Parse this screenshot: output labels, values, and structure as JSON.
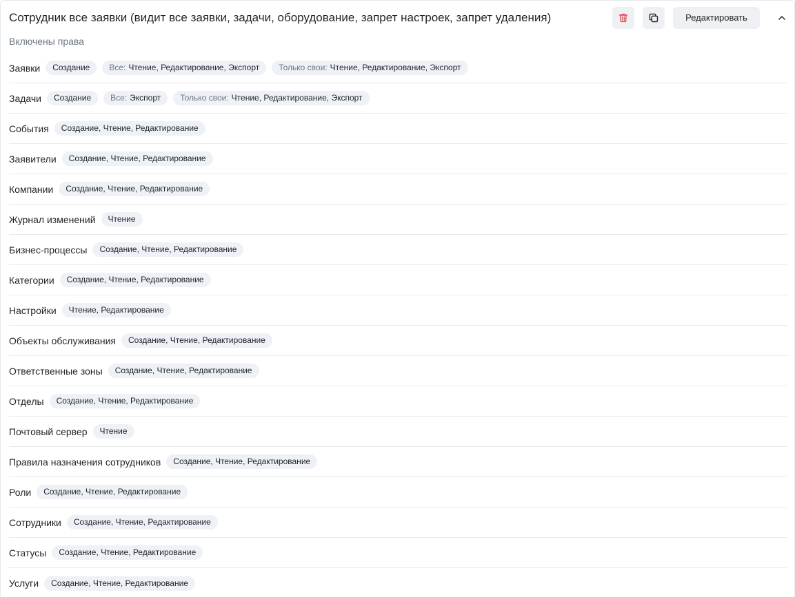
{
  "header": {
    "title": "Сотрудник все заявки (видит все заявки, задачи, оборудование, запрет настроек, запрет удаления)",
    "edit_label": "Редактировать",
    "delete_icon": "trash-icon",
    "copy_icon": "copy-icon",
    "collapse_icon": "chevron-up-icon",
    "delete_color": "#e5484d"
  },
  "subtitle": "Включены права",
  "rows": [
    {
      "label": "Заявки",
      "tags": [
        {
          "scope": "",
          "text": "Создание"
        },
        {
          "scope": "Все:",
          "text": "Чтение, Редактирование, Экспорт"
        },
        {
          "scope": "Только свои:",
          "text": "Чтение, Редактирование, Экспорт"
        }
      ]
    },
    {
      "label": "Задачи",
      "tags": [
        {
          "scope": "",
          "text": "Создание"
        },
        {
          "scope": "Все:",
          "text": "Экспорт"
        },
        {
          "scope": "Только свои:",
          "text": "Чтение, Редактирование, Экспорт"
        }
      ]
    },
    {
      "label": "События",
      "tags": [
        {
          "scope": "",
          "text": "Создание, Чтение, Редактирование"
        }
      ]
    },
    {
      "label": "Заявители",
      "tags": [
        {
          "scope": "",
          "text": "Создание, Чтение, Редактирование"
        }
      ]
    },
    {
      "label": "Компании",
      "tags": [
        {
          "scope": "",
          "text": "Создание, Чтение, Редактирование"
        }
      ]
    },
    {
      "label": "Журнал изменений",
      "tags": [
        {
          "scope": "",
          "text": "Чтение"
        }
      ]
    },
    {
      "label": "Бизнес-процессы",
      "tags": [
        {
          "scope": "",
          "text": "Создание, Чтение, Редактирование"
        }
      ]
    },
    {
      "label": "Категории",
      "tags": [
        {
          "scope": "",
          "text": "Создание, Чтение, Редактирование"
        }
      ]
    },
    {
      "label": "Настройки",
      "tags": [
        {
          "scope": "",
          "text": "Чтение, Редактирование"
        }
      ]
    },
    {
      "label": "Объекты обслуживания",
      "tags": [
        {
          "scope": "",
          "text": "Создание, Чтение, Редактирование"
        }
      ]
    },
    {
      "label": "Ответственные зоны",
      "tags": [
        {
          "scope": "",
          "text": "Создание, Чтение, Редактирование"
        }
      ]
    },
    {
      "label": "Отделы",
      "tags": [
        {
          "scope": "",
          "text": "Создание, Чтение, Редактирование"
        }
      ]
    },
    {
      "label": "Почтовый сервер",
      "tags": [
        {
          "scope": "",
          "text": "Чтение"
        }
      ]
    },
    {
      "label": "Правила назначения сотрудников",
      "tags": [
        {
          "scope": "",
          "text": "Создание, Чтение, Редактирование"
        }
      ]
    },
    {
      "label": "Роли",
      "tags": [
        {
          "scope": "",
          "text": "Создание, Чтение, Редактирование"
        }
      ]
    },
    {
      "label": "Сотрудники",
      "tags": [
        {
          "scope": "",
          "text": "Создание, Чтение, Редактирование"
        }
      ]
    },
    {
      "label": "Статусы",
      "tags": [
        {
          "scope": "",
          "text": "Создание, Чтение, Редактирование"
        }
      ]
    },
    {
      "label": "Услуги",
      "tags": [
        {
          "scope": "",
          "text": "Создание, Чтение, Редактирование"
        }
      ]
    }
  ]
}
